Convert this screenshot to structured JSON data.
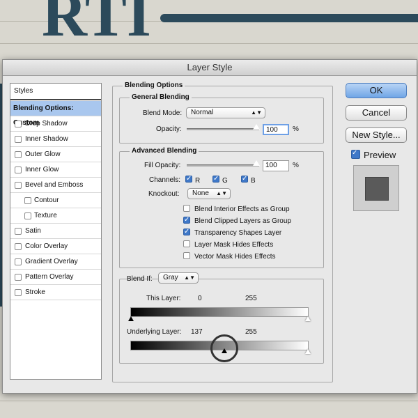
{
  "dialog": {
    "title": "Layer Style"
  },
  "styles_panel": {
    "header": "Styles",
    "selected": "Blending Options: Custom",
    "items": [
      {
        "label": "Drop Shadow",
        "checked": false
      },
      {
        "label": "Inner Shadow",
        "checked": false
      },
      {
        "label": "Outer Glow",
        "checked": false
      },
      {
        "label": "Inner Glow",
        "checked": false
      },
      {
        "label": "Bevel and Emboss",
        "checked": false
      },
      {
        "label": "Contour",
        "checked": false
      },
      {
        "label": "Texture",
        "checked": false
      },
      {
        "label": "Satin",
        "checked": false
      },
      {
        "label": "Color Overlay",
        "checked": false
      },
      {
        "label": "Gradient Overlay",
        "checked": false
      },
      {
        "label": "Pattern Overlay",
        "checked": false
      },
      {
        "label": "Stroke",
        "checked": false
      }
    ]
  },
  "blending": {
    "section_title": "Blending Options",
    "general": {
      "title": "General Blending",
      "blend_mode_label": "Blend Mode:",
      "blend_mode_value": "Normal",
      "opacity_label": "Opacity:",
      "opacity_value": "100",
      "percent": "%"
    },
    "advanced": {
      "title": "Advanced Blending",
      "fill_opacity_label": "Fill Opacity:",
      "fill_opacity_value": "100",
      "percent": "%",
      "channels_label": "Channels:",
      "channels": [
        "R",
        "G",
        "B"
      ],
      "knockout_label": "Knockout:",
      "knockout_value": "None",
      "options": [
        {
          "label": "Blend Interior Effects as Group",
          "checked": false
        },
        {
          "label": "Blend Clipped Layers as Group",
          "checked": true
        },
        {
          "label": "Transparency Shapes Layer",
          "checked": true
        },
        {
          "label": "Layer Mask Hides Effects",
          "checked": false
        },
        {
          "label": "Vector Mask Hides Effects",
          "checked": false
        }
      ]
    },
    "blend_if": {
      "label": "Blend If:",
      "value": "Gray",
      "this_layer_label": "This Layer:",
      "this_layer_low": "0",
      "this_layer_high": "255",
      "underlying_label": "Underlying Layer:",
      "underlying_low": "137",
      "underlying_high": "255"
    }
  },
  "buttons": {
    "ok": "OK",
    "cancel": "Cancel",
    "new_style": "New Style...",
    "preview": "Preview"
  },
  "colors": {
    "accent": "#3f78c8",
    "selected_row": "#a9c7ee",
    "background_text": "#2c4a5b"
  }
}
